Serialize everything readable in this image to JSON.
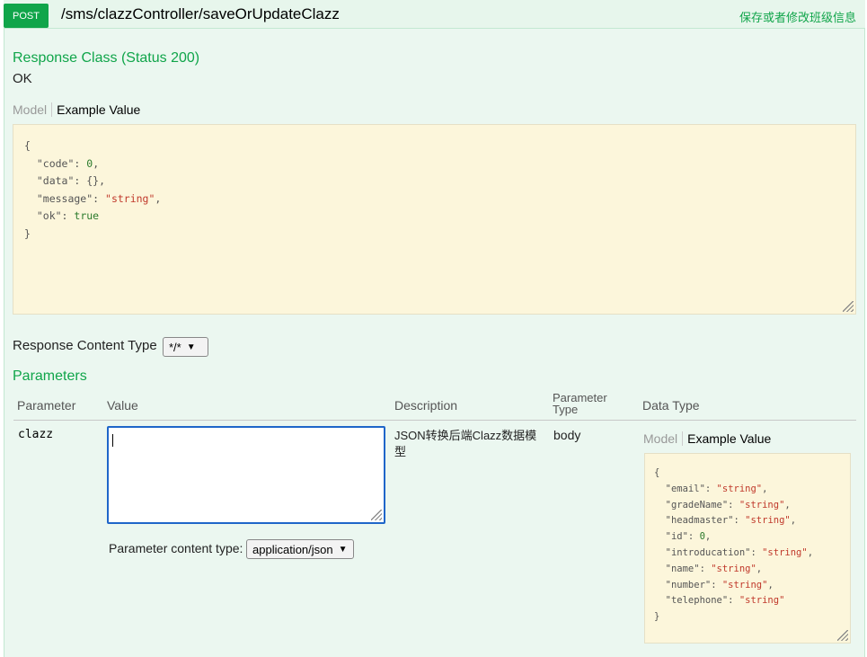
{
  "operation": {
    "method": "POST",
    "path": "/sms/clazzController/saveOrUpdateClazz",
    "summary": "保存或者修改班级信息"
  },
  "response_class": {
    "title": "Response Class (Status 200)",
    "status_text": "OK",
    "tab_model": "Model",
    "tab_example": "Example Value",
    "example_lines": [
      [
        {
          "t": "k",
          "v": "{"
        }
      ],
      [
        {
          "t": "k",
          "v": "  \"code\": "
        },
        {
          "t": "n",
          "v": "0"
        },
        {
          "t": "k",
          "v": ","
        }
      ],
      [
        {
          "t": "k",
          "v": "  \"data\": {},"
        }
      ],
      [
        {
          "t": "k",
          "v": "  \"message\": "
        },
        {
          "t": "s",
          "v": "\"string\""
        },
        {
          "t": "k",
          "v": ","
        }
      ],
      [
        {
          "t": "k",
          "v": "  \"ok\": "
        },
        {
          "t": "n",
          "v": "true"
        }
      ],
      [
        {
          "t": "k",
          "v": "}"
        }
      ]
    ]
  },
  "response_content_type": {
    "label": "Response Content Type",
    "value": "*/*"
  },
  "parameters": {
    "title": "Parameters",
    "headers": {
      "parameter": "Parameter",
      "value": "Value",
      "description": "Description",
      "parameter_type": "Parameter Type",
      "data_type": "Data Type"
    },
    "rows": [
      {
        "name": "clazz",
        "value": "",
        "description": "JSON转换后端Clazz数据模型",
        "param_type": "body",
        "content_type_label": "Parameter content type:",
        "content_type_value": "application/json",
        "tab_model": "Model",
        "tab_example": "Example Value",
        "example_lines": [
          [
            {
              "t": "k",
              "v": "{"
            }
          ],
          [
            {
              "t": "k",
              "v": "  \"email\": "
            },
            {
              "t": "s",
              "v": "\"string\""
            },
            {
              "t": "k",
              "v": ","
            }
          ],
          [
            {
              "t": "k",
              "v": "  \"gradeName\": "
            },
            {
              "t": "s",
              "v": "\"string\""
            },
            {
              "t": "k",
              "v": ","
            }
          ],
          [
            {
              "t": "k",
              "v": "  \"headmaster\": "
            },
            {
              "t": "s",
              "v": "\"string\""
            },
            {
              "t": "k",
              "v": ","
            }
          ],
          [
            {
              "t": "k",
              "v": "  \"id\": "
            },
            {
              "t": "n",
              "v": "0"
            },
            {
              "t": "k",
              "v": ","
            }
          ],
          [
            {
              "t": "k",
              "v": "  \"introducation\": "
            },
            {
              "t": "s",
              "v": "\"string\""
            },
            {
              "t": "k",
              "v": ","
            }
          ],
          [
            {
              "t": "k",
              "v": "  \"name\": "
            },
            {
              "t": "s",
              "v": "\"string\""
            },
            {
              "t": "k",
              "v": ","
            }
          ],
          [
            {
              "t": "k",
              "v": "  \"number\": "
            },
            {
              "t": "s",
              "v": "\"string\""
            },
            {
              "t": "k",
              "v": ","
            }
          ],
          [
            {
              "t": "k",
              "v": "  \"telephone\": "
            },
            {
              "t": "s",
              "v": "\"string\""
            }
          ],
          [
            {
              "t": "k",
              "v": "}"
            }
          ]
        ]
      }
    ]
  },
  "colors": {
    "accent_green": "#10a54a",
    "body_bg": "#ebf7f0",
    "code_bg": "#fcf6db",
    "focus_blue": "#1f66c9"
  }
}
